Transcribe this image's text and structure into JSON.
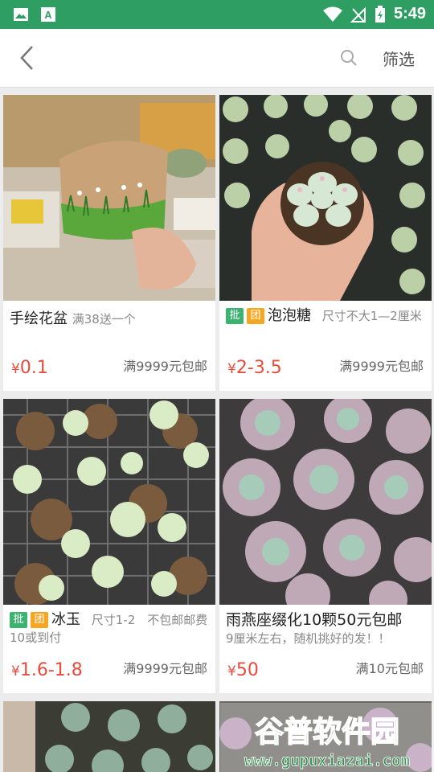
{
  "status": {
    "time": "5:49"
  },
  "topbar": {
    "filter_label": "筛选"
  },
  "products": [
    {
      "title": "手绘花盆",
      "desc": "满38送一个",
      "price": "0.1",
      "shipping": "满9999元包邮",
      "badges": []
    },
    {
      "title": "泡泡糖",
      "desc": "尺寸不大1—2厘米",
      "price": "2-3.5",
      "shipping": "满9999元包邮",
      "badges": [
        "批",
        "团"
      ]
    },
    {
      "title": "冰玉",
      "desc": "尺寸1-2　不包邮邮费10或到付",
      "price": "1.6-1.8",
      "shipping": "满9999元包邮",
      "badges": [
        "批",
        "团"
      ]
    },
    {
      "title": "雨燕座缀化10颗50元包邮",
      "desc": "9厘米左右，随机挑好的发！！",
      "price": "50",
      "shipping": "满10元包邮",
      "badges": []
    }
  ],
  "currency_symbol": "¥",
  "watermark": {
    "text": "谷普软件园",
    "url": "www.gupuxiazai.com"
  },
  "colors": {
    "status_bar": "#2f9e63",
    "price": "#e94b3c",
    "badge_pi": "#3cb371",
    "badge_tuan": "#f5a623"
  }
}
